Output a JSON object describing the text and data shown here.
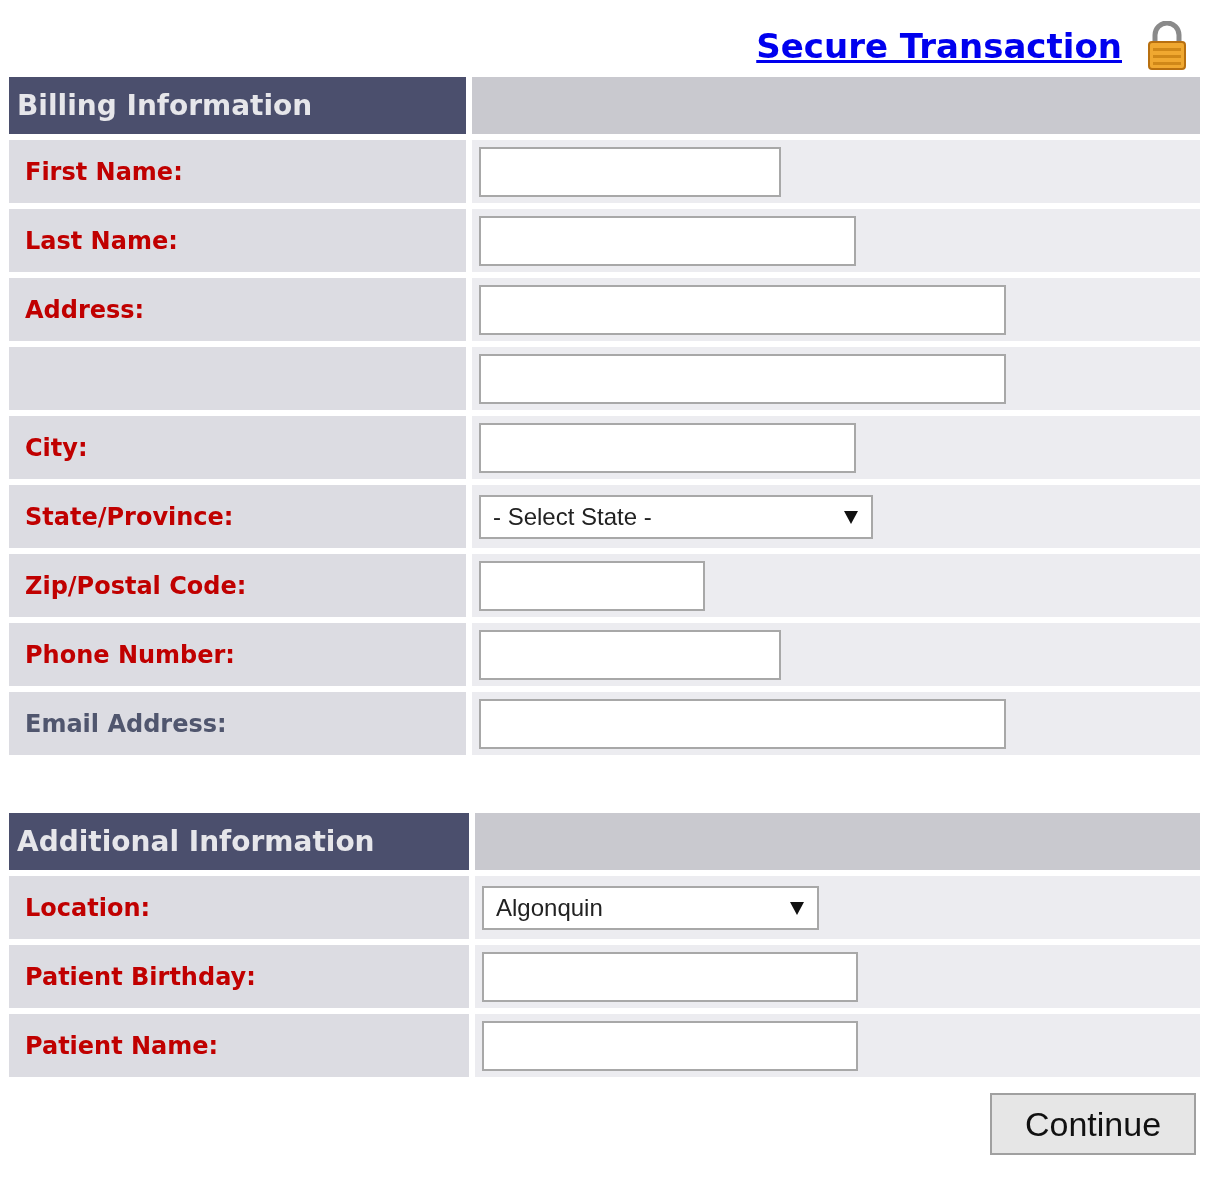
{
  "secure_link": {
    "label": "Secure Transaction"
  },
  "sections": [
    {
      "title": "Billing Information",
      "fields": [
        {
          "label": "First Name:",
          "required": true,
          "kind": "text"
        },
        {
          "label": "Last Name:",
          "required": true,
          "kind": "text"
        },
        {
          "label": "Address:",
          "required": true,
          "kind": "text"
        },
        {
          "kind": "text"
        },
        {
          "label": "City:",
          "required": true,
          "kind": "text"
        },
        {
          "label": "State/Province:",
          "required": true,
          "kind": "select",
          "value": "- Select State -"
        },
        {
          "label": "Zip/Postal Code:",
          "required": true,
          "kind": "text"
        },
        {
          "label": "Phone Number:",
          "required": true,
          "kind": "text"
        },
        {
          "label": "Email Address:",
          "required": false,
          "kind": "text"
        }
      ]
    },
    {
      "title": "Additional Information",
      "fields": [
        {
          "label": "Location:",
          "required": true,
          "kind": "select",
          "value": "Algonquin"
        },
        {
          "label": "Patient Birthday:",
          "required": true,
          "kind": "text"
        },
        {
          "label": "Patient Name:",
          "required": true,
          "kind": "text"
        }
      ]
    }
  ],
  "continue_button": {
    "label": "Continue"
  }
}
